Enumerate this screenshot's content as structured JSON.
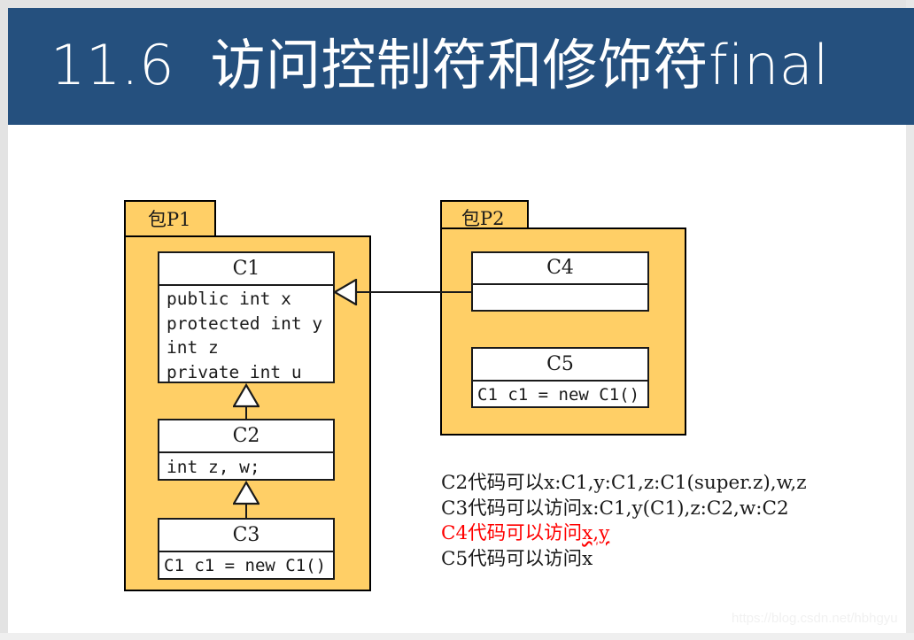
{
  "slide": {
    "title": "11.6  访问控制符和修饰符final",
    "background_color": "#ffffff",
    "banner_color": "#25507e",
    "package_fill": "#ffcf66",
    "accent_red": "#ff0000"
  },
  "diagram": {
    "type": "uml-class-diagram",
    "packages": [
      {
        "id": "p1",
        "label": "包P1"
      },
      {
        "id": "p2",
        "label": "包P2"
      }
    ],
    "classes": [
      {
        "id": "c1",
        "name": "C1",
        "package": "包P1",
        "members": "public int x\nprotected int y\nint z\nprivate int u"
      },
      {
        "id": "c2",
        "name": "C2",
        "package": "包P1",
        "members": "int z, w;"
      },
      {
        "id": "c3",
        "name": "C3",
        "package": "包P1",
        "members": "C1 c1 = new C1()"
      },
      {
        "id": "c4",
        "name": "C4",
        "package": "包P2",
        "members": ""
      },
      {
        "id": "c5",
        "name": "C5",
        "package": "包P2",
        "members": "C1 c1 = new C1()"
      }
    ],
    "relations": [
      {
        "kind": "generalization",
        "from": "C2",
        "to": "C1"
      },
      {
        "kind": "generalization",
        "from": "C3",
        "to": "C2"
      },
      {
        "kind": "generalization",
        "from": "C4",
        "to": "C1"
      }
    ]
  },
  "notes": {
    "lines": [
      {
        "text": "C2代码可以x:C1,y:C1,z:C1(super.z),w,z",
        "color": "black",
        "squiggle": ""
      },
      {
        "text": "C3代码可以访问x:C1,y(C1),z:C2,w:C2",
        "color": "black",
        "squiggle": ""
      },
      {
        "text": "C4代码可以访问",
        "color": "red",
        "squiggle": "x,y"
      },
      {
        "text": "C5代码可以访问x",
        "color": "black",
        "squiggle": ""
      }
    ]
  },
  "watermark": {
    "text": "https://blog.csdn.net/hbhgyu"
  }
}
